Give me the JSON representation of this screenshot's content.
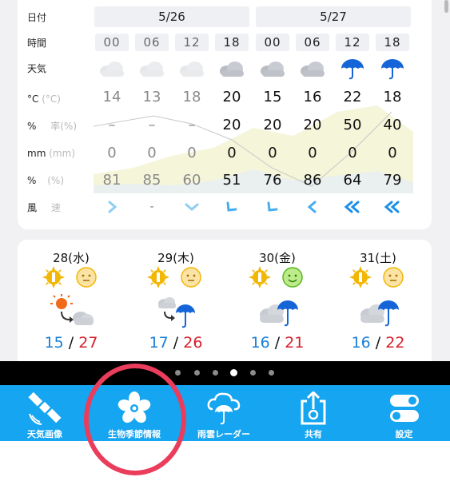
{
  "hourly": {
    "row_labels": {
      "date": "日付",
      "time": "時間",
      "weather": "天気",
      "temp": "°C",
      "temp_ghost": "(°C)",
      "precip_prob": "%",
      "precip_prob_ghost": "率(%)",
      "precip_amount": "mm",
      "precip_amount_ghost": "(mm)",
      "humidity": "%",
      "humidity_ghost": "(%)",
      "wind": "風",
      "wind_ghost": "速"
    },
    "dates": [
      "5/26",
      "5/27"
    ],
    "hours": [
      "00",
      "06",
      "12",
      "18",
      "00",
      "06",
      "12",
      "18"
    ],
    "weather_icons": [
      "cloud-icon",
      "cloud-icon",
      "cloud-icon",
      "cloud-icon",
      "cloud-icon",
      "cloud-icon",
      "umbrella-icon",
      "umbrella-icon"
    ],
    "temperature": [
      "14",
      "13",
      "18",
      "20",
      "15",
      "16",
      "22",
      "18"
    ],
    "precip_probability": [
      "–",
      "–",
      "–",
      "20",
      "20",
      "20",
      "50",
      "40"
    ],
    "precip_amount": [
      "0",
      "0",
      "0",
      "0",
      "0",
      "0",
      "0",
      "0"
    ],
    "humidity": [
      "81",
      "85",
      "60",
      "51",
      "76",
      "86",
      "64",
      "79"
    ],
    "wind": [
      "wind-chevron-right-icon",
      "dash",
      "wind-chevron-down-icon",
      "wind-chevron-down-left-icon",
      "wind-chevron-down-left-icon",
      "wind-chevron-left-icon",
      "wind-double-left-icon",
      "wind-double-left-icon"
    ],
    "wind_dash": "-"
  },
  "daily": [
    {
      "label": "28(水)",
      "face": "neutral",
      "weather": "sun-to-cloud-icon",
      "low": "15",
      "sep": "/",
      "high": "27"
    },
    {
      "label": "29(木)",
      "face": "neutral",
      "weather": "cloud-to-rain-icon",
      "low": "17",
      "sep": "/",
      "high": "26"
    },
    {
      "label": "30(金)",
      "face": "happy",
      "weather": "cloud-rain-icon",
      "low": "16",
      "sep": "/",
      "high": "21"
    },
    {
      "label": "31(土)",
      "face": "neutral",
      "weather": "cloud-rain-icon",
      "low": "16",
      "sep": "/",
      "high": "22"
    }
  ],
  "pager": {
    "count": 6,
    "active_index": 3
  },
  "tabs": [
    {
      "label": "天気画像",
      "icon": "satellite-icon"
    },
    {
      "label": "生物季節情報",
      "icon": "flower-icon"
    },
    {
      "label": "雨雲レーダー",
      "icon": "rain-cloud-umbrella-icon"
    },
    {
      "label": "共有",
      "icon": "share-icon"
    },
    {
      "label": "設定",
      "icon": "settings-toggle-icon"
    }
  ],
  "colors": {
    "tabbar": "#16a5f0",
    "highlight_ring": "#ea3d5b",
    "low_temp": "#1b7fd6",
    "high_temp": "#d61f2a",
    "rain_icon": "#1565d8",
    "chart_fill": "#f4f5d9"
  }
}
